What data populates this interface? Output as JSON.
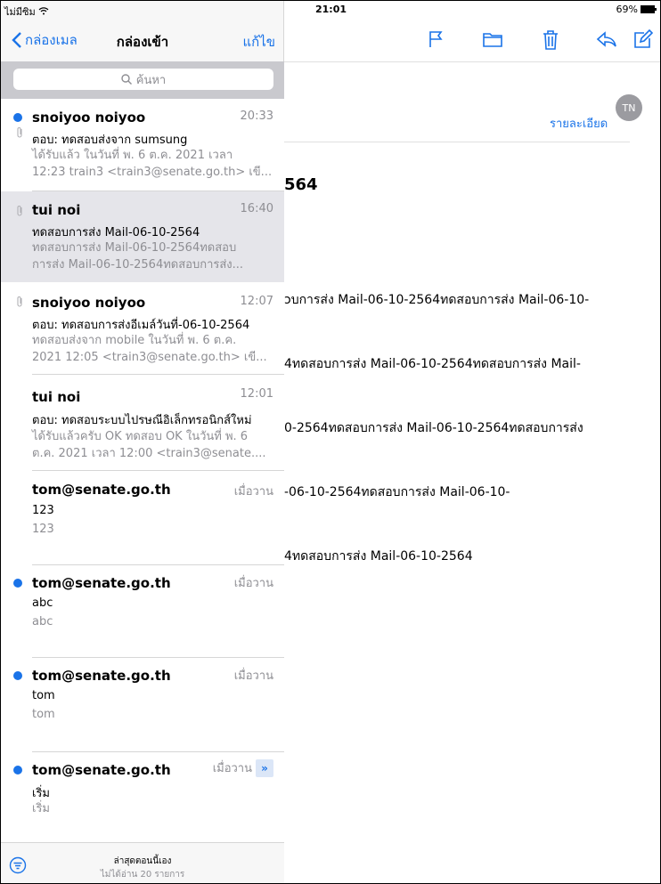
{
  "status": {
    "carrier": "ไม่มีซิม",
    "time": "21:01",
    "battery": "69%"
  },
  "nav": {
    "back_label": "กล่องเมล",
    "title": "กล่องเข้า",
    "edit_label": "แก้ไข"
  },
  "search": {
    "placeholder": "ค้นหา"
  },
  "messages": [
    {
      "sender": "snoiyoo noiyoo",
      "time": "20:33",
      "subject": "ตอบ: ทดสอบส่งจาก sumsung",
      "preview1": "ได้รับแล้ว ในวันที่ พ. 6 ต.ค. 2021 เวลา",
      "preview2": "12:23 train3 <train3@senate.go.th> เขี..."
    },
    {
      "sender": "tui noi",
      "time": "16:40",
      "subject": "ทดสอบการส่ง Mail-06-10-2564",
      "preview1": "ทดสอบการส่ง Mail-06-10-2564ทดสอบ",
      "preview2": "การส่ง Mail-06-10-2564ทดสอบการส่ง..."
    },
    {
      "sender": "snoiyoo noiyoo",
      "time": "12:07",
      "subject": "ตอบ: ทดสอบการส่งอีเมล์วันที่-06-10-2564",
      "preview1": "ทดสอบส่งจาก mobile ในวันที่ พ. 6 ต.ค.",
      "preview2": "2021 12:05 <train3@senate.go.th> เขี..."
    },
    {
      "sender": "tui noi",
      "time": "12:01",
      "subject": "ตอบ: ทดสอบระบบไปรษณีอิเล็กทรอนิกส์ใหม่",
      "preview1": "ได้รับแล้วครับ OK ทดสอบ OK ในวันที่ พ. 6",
      "preview2": "ต.ค. 2021 เวลา 12:00 <train3@senate...."
    },
    {
      "sender": "tom@senate.go.th",
      "time": "เมื่อวาน",
      "subject": "123",
      "preview1": "123"
    },
    {
      "sender": "tom@senate.go.th",
      "time": "เมื่อวาน",
      "subject": "abc",
      "preview1": "abc"
    },
    {
      "sender": "tom@senate.go.th",
      "time": "เมื่อวาน",
      "subject": "tom",
      "preview1": "tom"
    },
    {
      "sender": "tom@senate.go.th",
      "time": "เมื่อวาน",
      "subject": "เริ่ม",
      "preview1": "เริ่ม"
    }
  ],
  "bottom": {
    "updated": "ล่าสุดตอนนี้เอง",
    "unread": "ไม่ได้อ่าน 20 รายการ"
  },
  "detail": {
    "avatar": "TN",
    "details_link": "รายละเอียด",
    "subject_fragment": "564",
    "body_lines": [
      "ɔบการส่ง Mail-06-10-2564ทดสอบการส่ง Mail-06-10-",
      "4ทดสอบการส่ง Mail-06-10-2564ทดสอบการส่ง Mail-",
      "0-2564ทดสอบการส่ง Mail-06-10-2564ทดสอบการส่ง",
      "-06-10-2564ทดสอบการส่ง Mail-06-10-",
      "4ทดสอบการส่ง Mail-06-10-2564"
    ]
  },
  "colors": {
    "accent": "#1a73e8",
    "selected_row": "#e5e5ea"
  }
}
